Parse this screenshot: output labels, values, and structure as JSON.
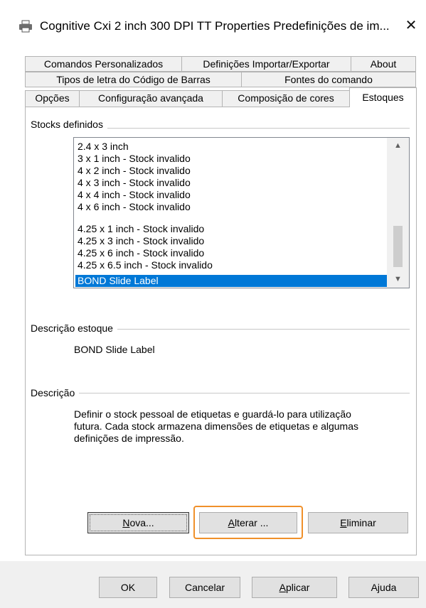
{
  "window": {
    "title": "Cognitive Cxi 2 inch 300 DPI TT Properties Predefinições de im...",
    "close_glyph": "✕",
    "printer_icon": "printer-icon"
  },
  "tabs": {
    "row1": [
      "Comandos Personalizados",
      "Definições Importar/Exportar",
      "About"
    ],
    "row2": [
      "Tipos de letra do Código de Barras",
      "Fontes do comando"
    ],
    "row3": [
      "Opções",
      "Configuração avançada",
      "Composição de cores",
      "Estoques"
    ],
    "active": "Estoques"
  },
  "stocks": {
    "label": "Stocks definidos",
    "items": [
      "2.4 x 3 inch",
      "3 x 1 inch - Stock invalido",
      "4 x 2 inch - Stock invalido",
      "4 x 3 inch - Stock invalido",
      "4 x 4 inch - Stock invalido",
      "4 x 6 inch - Stock invalido",
      "4.25 x 1 inch - Stock invalido",
      "4.25 x 3 inch - Stock invalido",
      "4.25 x 6 inch - Stock invalido",
      "4.25 x 6.5 inch - Stock invalido",
      "BOND Slide Label"
    ],
    "selected": "BOND Slide Label"
  },
  "stock_description": {
    "label": "Descrição estoque",
    "value": "BOND Slide Label"
  },
  "description": {
    "label": "Descrição",
    "lines": [
      "Definir o stock pessoal de etiquetas e guardá-lo para utilização",
      "futura. Cada stock armazena dimensões de etiquetas e algumas",
      "definições de impressão."
    ]
  },
  "actions": {
    "new_mnemonic": "N",
    "new_rest": "ova...",
    "edit_mnemonic": "A",
    "edit_rest": "lterar ...",
    "delete_mnemonic": "E",
    "delete_rest": "liminar"
  },
  "footer": {
    "ok": "OK",
    "cancel": "Cancelar",
    "apply_mnemonic": "A",
    "apply_rest": "plicar",
    "help": "Ajuda"
  },
  "colors": {
    "selection": "#0078d7",
    "focus_ring": "#f0902a"
  }
}
